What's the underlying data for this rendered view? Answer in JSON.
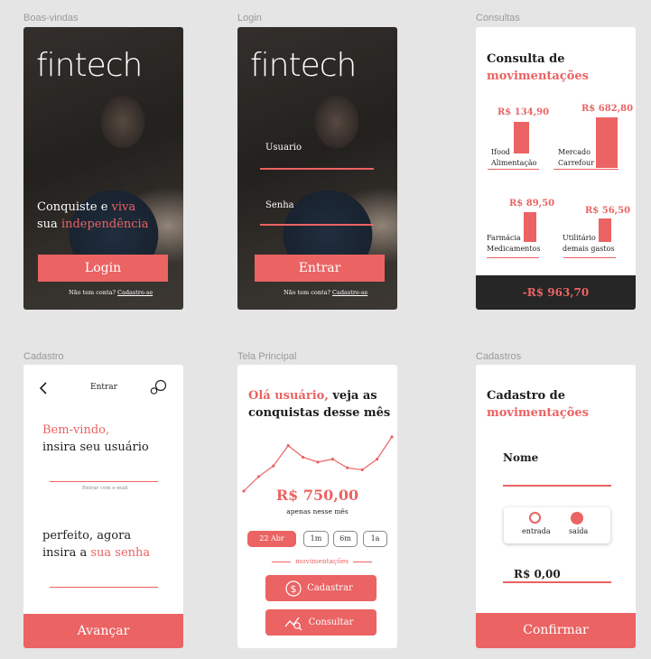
{
  "frames": {
    "welcome": "Boas-vindas",
    "login": "Login",
    "consultas": "Consultas",
    "cadastro": "Cadastro",
    "main": "Tela Principal",
    "cadastros": "Cadastros"
  },
  "brand": "fintech",
  "welcome": {
    "line1_a": "Conquiste e ",
    "line1_b": "viva",
    "line2_a": "sua ",
    "line2_b": "independência",
    "login_button": "Login",
    "no_account": "Não tem conta? ",
    "signup_link": "Cadastre-se"
  },
  "login": {
    "user_label": "Usuario",
    "password_label": "Senha",
    "enter_button": "Entrar",
    "no_account": "Não tem conta? ",
    "signup_link": "Cadastre-se"
  },
  "consultas": {
    "title_a": "Consulta de",
    "title_b": "movimentações",
    "items": [
      {
        "value": "R$ 134,90",
        "line1": "Ifood",
        "line2": "Alimentação"
      },
      {
        "value": "R$ 682,80",
        "line1": "Mercado",
        "line2": "Carrefour"
      },
      {
        "value": "R$ 89,50",
        "line1": "Farmácia",
        "line2": "Medicamentos"
      },
      {
        "value": "R$ 56,50",
        "line1": "Utilitário",
        "line2": "demais gastos"
      }
    ],
    "total": "-R$ 963,70"
  },
  "cadastro": {
    "header_title": "Entrar",
    "welcome_a": "Bem-vindo,",
    "welcome_b": "insira seu usuário",
    "email_hint": "Entrar com e-mail",
    "password_a": "perfeito, agora",
    "password_b": "insira a ",
    "password_c": "sua senha",
    "next_button": "Avançar"
  },
  "main": {
    "greeting_a": "Olá usuário,",
    "greeting_b": " veja as",
    "greeting_c": "conquistas desse mês",
    "amount": "R$ 750,00",
    "amount_caption": "apenas nesse mês",
    "ranges": [
      "22 Abr",
      "1m",
      "6m",
      "1a"
    ],
    "section": "movimentações",
    "cadastrar": "Cadastrar",
    "consultar": "Consultar",
    "line_values": [
      0,
      15,
      26,
      47,
      35,
      30,
      33,
      24,
      22,
      33,
      56
    ]
  },
  "cadastros": {
    "title_a": "Cadastro de",
    "title_b": "movimentações",
    "name_label": "Nome",
    "opt_in": "entrada",
    "opt_out": "saída",
    "value": "R$ 0,00",
    "confirm_button": "Confirmar"
  }
}
